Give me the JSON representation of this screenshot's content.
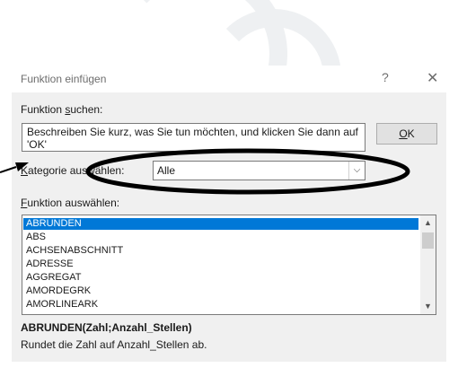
{
  "dialog": {
    "title": "Funktion einfügen",
    "help_glyph": "?",
    "close_glyph": "✕",
    "search_label_before": "Funktion ",
    "search_label_accel": "s",
    "search_label_after": "uchen:",
    "search_text": "Beschreiben Sie kurz, was Sie tun möchten, und klicken Sie dann auf 'OK'",
    "ok_accel": "O",
    "ok_rest": "K",
    "category_label_accel": "K",
    "category_label_rest": "ategorie auswählen:",
    "category_value": "Alle",
    "select_label_accel": "F",
    "select_label_rest": "unktion auswählen:",
    "functions": [
      "ABRUNDEN",
      "ABS",
      "ACHSENABSCHNITT",
      "ADRESSE",
      "AGGREGAT",
      "AMORDEGRK",
      "AMORLINEARK"
    ],
    "selected_index": 0,
    "signature": "ABRUNDEN(Zahl;Anzahl_Stellen)",
    "description": "Rundet die Zahl auf Anzahl_Stellen ab."
  },
  "annotation": {
    "ellipse_color": "#000000",
    "arrow_color": "#000000"
  },
  "colors": {
    "selection": "#0078d7",
    "dialog_bg": "#f0f0f0"
  }
}
